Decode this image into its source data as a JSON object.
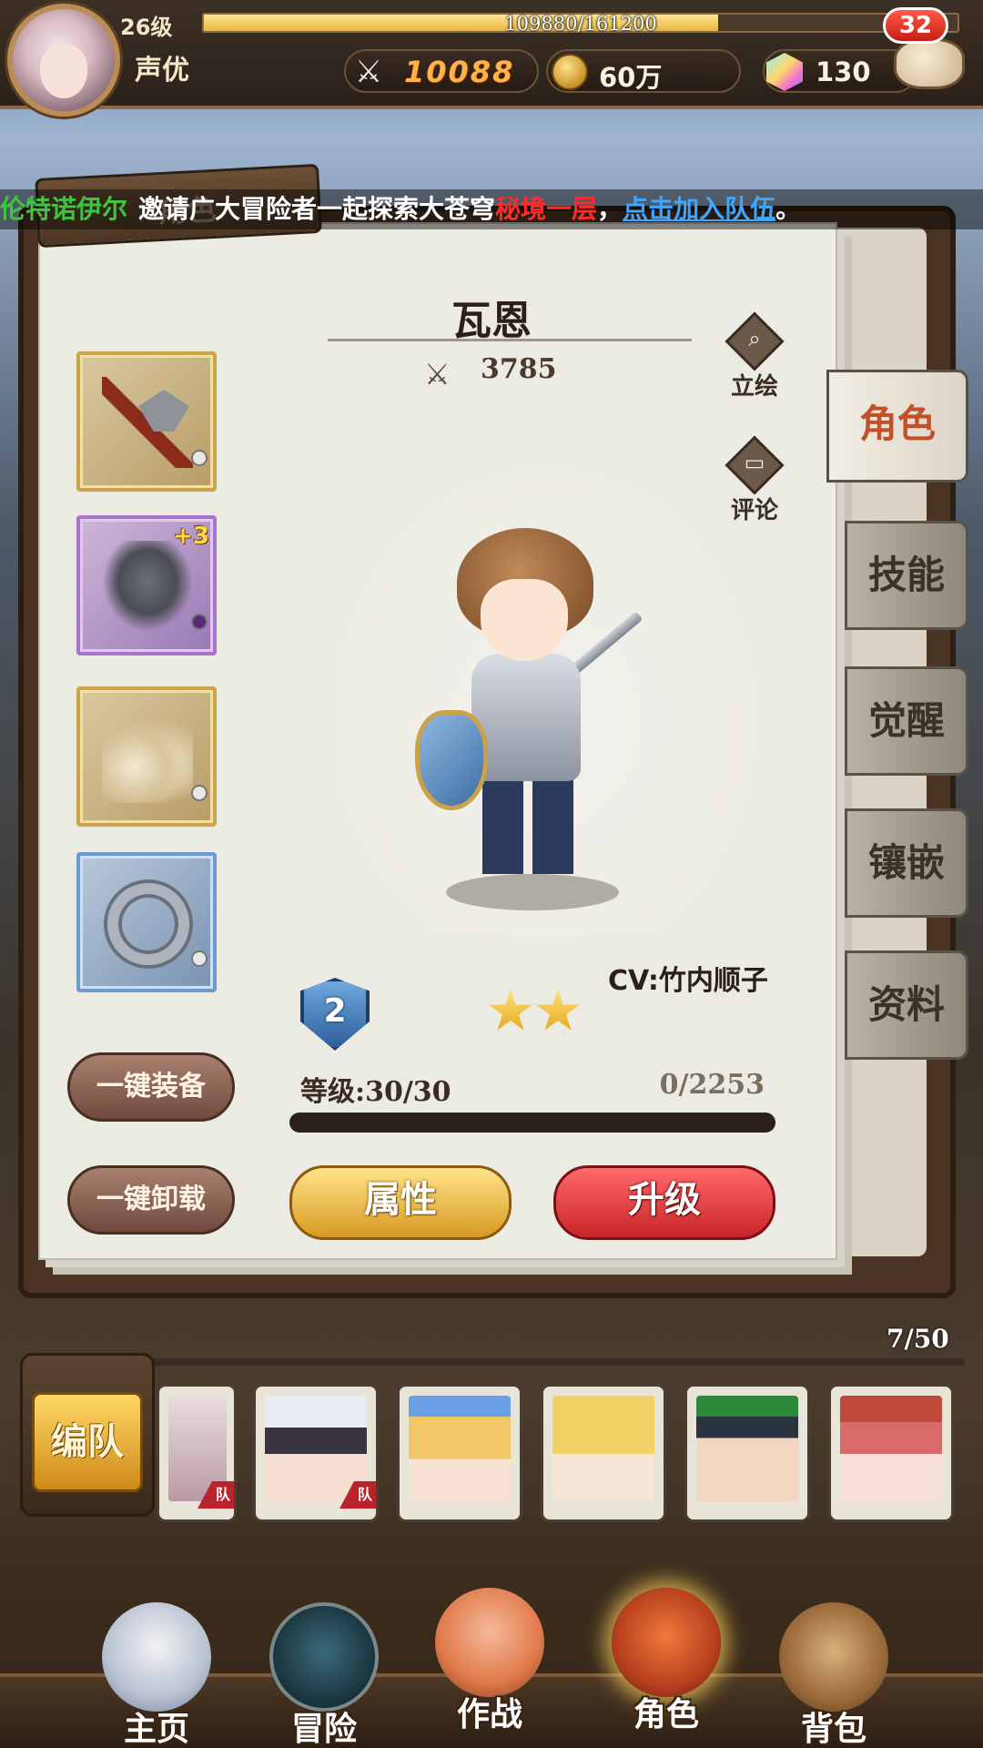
{
  "player": {
    "level_label": "26级",
    "xp_text": "109880/161200",
    "xp_fraction": 0.682,
    "name": "声优",
    "power": "10088",
    "gold": "60万",
    "gems": "130",
    "chat_badge": "32"
  },
  "marquee": {
    "name": "伦特诺伊尔",
    "text": "邀请广大冒险者一起探索大苍穹",
    "place": "秘境一层",
    "separator": "，",
    "link": "点击加入队伍",
    "end": "。"
  },
  "panel": {
    "section_label": "角色"
  },
  "hero": {
    "name": "瓦恩",
    "power": "3785",
    "portrait_label": "立绘",
    "review_label": "评论",
    "cv": "CV:竹内顺子",
    "rank": "2",
    "stars": 2,
    "level_text": "等级:30/30",
    "exp_text": "0/2253",
    "armor_bonus": "+3"
  },
  "buttons": {
    "equip_all": "一键装备",
    "unequip_all": "一键卸载",
    "attributes": "属性",
    "upgrade": "升级"
  },
  "tabs": [
    "角色",
    "技能",
    "觉醒",
    "镶嵌",
    "资料"
  ],
  "active_tab": "角色",
  "roster": {
    "count": "7/50",
    "team_button": "编队",
    "team_tag": "队"
  },
  "nav": [
    "主页",
    "冒险",
    "作战",
    "角色",
    "背包"
  ],
  "colors": {
    "accent_red": "#c81e14",
    "gold": "#e9b63b",
    "active_tab_text": "#c2502a"
  },
  "icons": {
    "power": "crossed-swords-icon",
    "gold": "coin-icon",
    "gems": "crystal-icon",
    "chat": "chat-bubble-icon"
  }
}
